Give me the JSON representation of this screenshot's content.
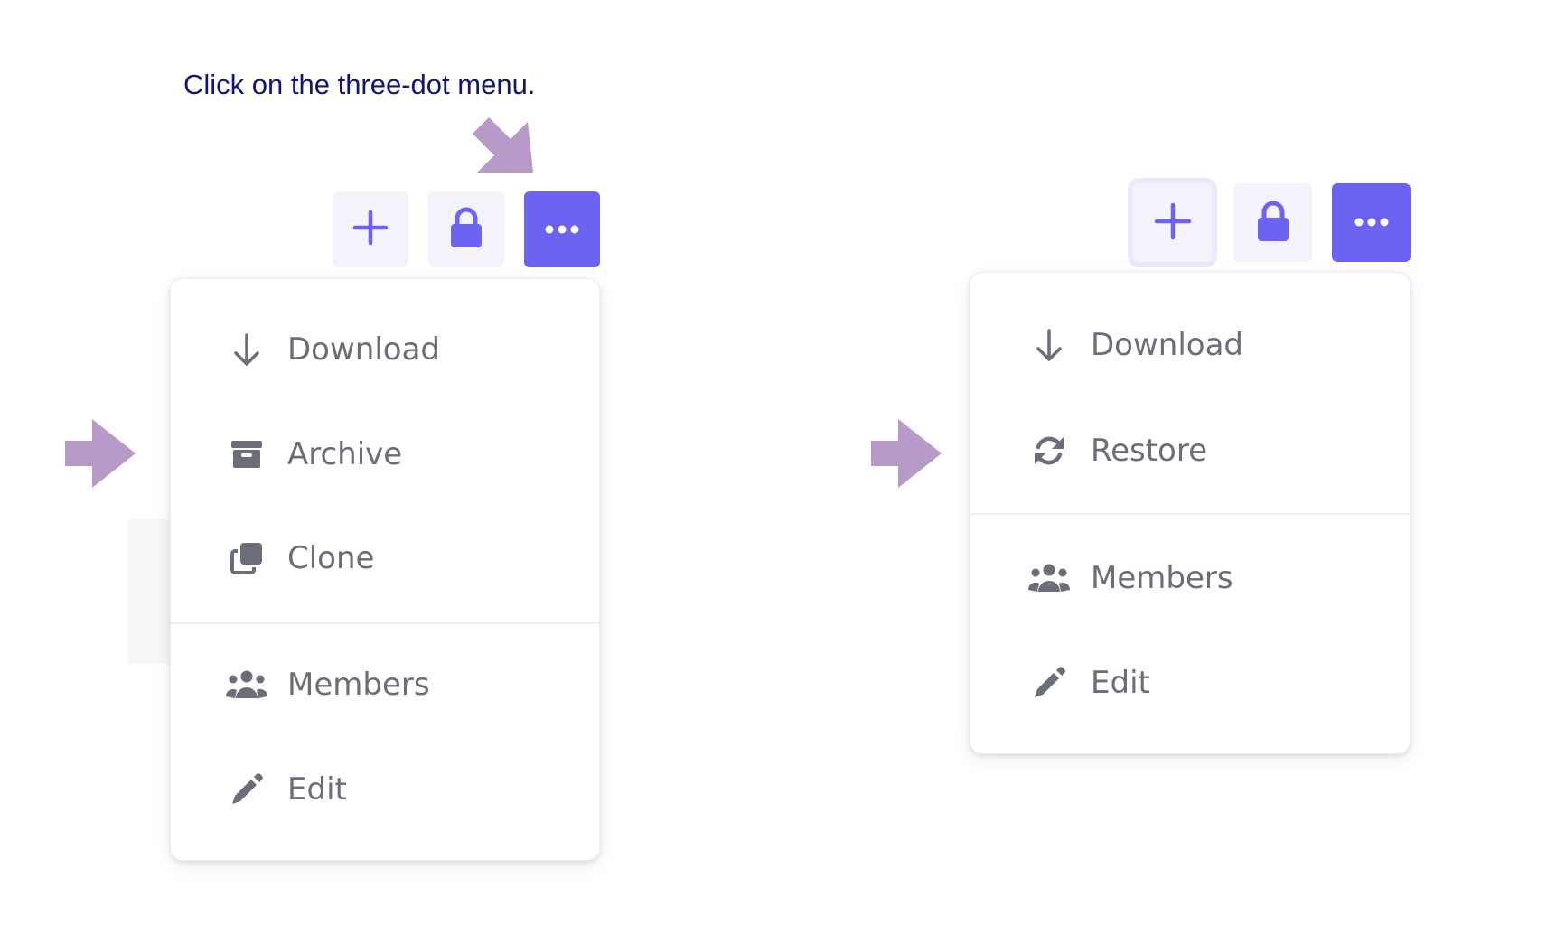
{
  "instruction": "Click on the three-dot menu.",
  "colors": {
    "accent": "#6c63f3",
    "hint_arrow": "#b79ac8",
    "menu_text": "#6b6d78",
    "instruction_text": "#13137a"
  },
  "left_panel": {
    "toolbar": {
      "add_icon": "plus-icon",
      "lock_icon": "lock-icon",
      "more_icon": "ellipsis-icon"
    },
    "menu": {
      "items": [
        {
          "label": "Download",
          "icon": "arrow-down-icon"
        },
        {
          "label": "Archive",
          "icon": "archive-box-icon"
        },
        {
          "label": "Clone",
          "icon": "clone-icon"
        },
        {
          "label": "Members",
          "icon": "users-icon"
        },
        {
          "label": "Edit",
          "icon": "pencil-icon"
        }
      ]
    }
  },
  "right_panel": {
    "toolbar": {
      "add_icon": "plus-icon",
      "lock_icon": "lock-icon",
      "more_icon": "ellipsis-icon"
    },
    "menu": {
      "items": [
        {
          "label": "Download",
          "icon": "arrow-down-icon"
        },
        {
          "label": "Restore",
          "icon": "sync-icon"
        },
        {
          "label": "Members",
          "icon": "users-icon"
        },
        {
          "label": "Edit",
          "icon": "pencil-icon"
        }
      ]
    }
  }
}
